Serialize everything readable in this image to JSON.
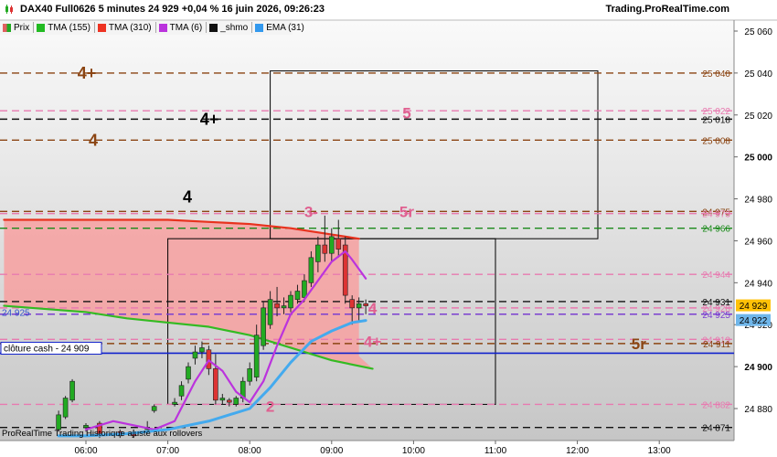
{
  "header": {
    "title": "DAX40 Full0626 5 minutes 24 929 +0,04 % 16 juin 2026, 09:26:23",
    "site": "Trading.ProRealTime.com"
  },
  "legend": [
    {
      "label": "Prix",
      "color": "#e06060"
    },
    {
      "label": "TMA (155)",
      "color": "#22bb22"
    },
    {
      "label": "TMA (310)",
      "color": "#ee3322"
    },
    {
      "label": "TMA (6)",
      "color": "#bb33dd"
    },
    {
      "label": "_shmo",
      "color": "#111111"
    },
    {
      "label": "EMA (31)",
      "color": "#3399ee"
    }
  ],
  "footer": "ProRealTime Trading  Historique ajusté aux rollovers",
  "chart_data": {
    "type": "candlestick",
    "y_ticks": [
      "25 060",
      "25 040",
      "25 020",
      "25 000",
      "24 980",
      "24 960",
      "24 940",
      "24 920",
      "24 900",
      "24 880"
    ],
    "x_ticks": [
      "06:00",
      "07:00",
      "08:00",
      "09:00",
      "10:00",
      "11:00",
      "12:00",
      "13:00"
    ],
    "ylim": [
      24866,
      25066
    ],
    "levels": [
      {
        "price": 25040,
        "color": "#8b4513",
        "label": "25 040",
        "text": "4+"
      },
      {
        "price": 25022,
        "color": "#e87ab0",
        "label": "25 022",
        "text": ""
      },
      {
        "price": 25018,
        "color": "#111111",
        "label": "25 018",
        "text": "4+"
      },
      {
        "price": 25008,
        "color": "#8b4513",
        "label": "25 008",
        "text": "4"
      },
      {
        "price": 24974,
        "color": "#8b4513",
        "label": "24 975",
        "text": "4"
      },
      {
        "price": 24973,
        "color": "#e87ab0",
        "label": "24 973",
        "text": ""
      },
      {
        "price": 24966,
        "color": "#1a8a1a",
        "label": "24 966",
        "text": ""
      },
      {
        "price": 24944,
        "color": "#e87ab0",
        "label": "24 944",
        "text": ""
      },
      {
        "price": 24931,
        "color": "#111111",
        "label": "24 931",
        "text": ""
      },
      {
        "price": 24928,
        "color": "#e87ab0",
        "label": "24 928",
        "text": ""
      },
      {
        "price": 24925,
        "color": "#7b3fd0",
        "label": "24 925",
        "text": ""
      },
      {
        "price": 24913,
        "color": "#e87ab0",
        "label": "24 913",
        "text": ""
      },
      {
        "price": 24911,
        "color": "#8b4513",
        "label": "24 911",
        "text": ""
      },
      {
        "price": 24882,
        "color": "#e87ab0",
        "label": "24 882",
        "text": ""
      },
      {
        "price": 24871,
        "color": "#111111",
        "label": "24 871",
        "text": ""
      }
    ],
    "level_texts": [
      {
        "text": "5",
        "color": "#e06090",
        "price": 25021,
        "x_time": "09:55"
      },
      {
        "text": "5r",
        "color": "#e06090",
        "price": 24974,
        "x_time": "09:55"
      },
      {
        "text": "3-",
        "color": "#e06090",
        "price": 24974,
        "x_time": "08:45"
      },
      {
        "text": "4",
        "color": "#e06090",
        "price": 24928,
        "x_time": "09:30"
      },
      {
        "text": "4+",
        "color": "#e06090",
        "price": 24912,
        "x_time": "09:30"
      },
      {
        "text": "2",
        "color": "#e06090",
        "price": 24881,
        "x_time": "08:15"
      },
      {
        "text": "5r",
        "color": "#8b4513",
        "price": 24911,
        "x_time": "12:45"
      }
    ],
    "boxes": [
      {
        "t0": "08:15",
        "t1": "12:15",
        "p0": 24961,
        "p1": 25041
      },
      {
        "t0": "07:00",
        "t1": "11:00",
        "p0": 24882,
        "p1": 24961
      }
    ],
    "right_labels": [
      {
        "text": "24 929",
        "bg": "#ffc107",
        "fg": "#000000",
        "price": 24929
      },
      {
        "text": "24 922",
        "bg": "#6fb6ea",
        "fg": "#000000",
        "price": 24922
      }
    ],
    "left_labels": [
      {
        "text": "24 925",
        "price": 24926,
        "color": "#3355cc"
      }
    ],
    "cloture": {
      "text": "clôture cash -  24 909",
      "price": 24909
    },
    "candles": [
      {
        "t": "05:40",
        "o": 24870,
        "h": 24879,
        "l": 24869,
        "c": 24877
      },
      {
        "t": "05:45",
        "o": 24876,
        "h": 24886,
        "l": 24875,
        "c": 24885
      },
      {
        "t": "05:50",
        "o": 24884,
        "h": 24894,
        "l": 24883,
        "c": 24893
      },
      {
        "t": "06:00",
        "o": 24871,
        "h": 24873,
        "l": 24869,
        "c": 24872
      },
      {
        "t": "06:10",
        "o": 24873,
        "h": 24874,
        "l": 24866,
        "c": 24868
      },
      {
        "t": "06:25",
        "o": 24869,
        "h": 24870,
        "l": 24866,
        "c": 24867
      },
      {
        "t": "06:35",
        "o": 24868,
        "h": 24870,
        "l": 24866,
        "c": 24867
      },
      {
        "t": "06:45",
        "o": 24870,
        "h": 24874,
        "l": 24868,
        "c": 24871
      },
      {
        "t": "06:50",
        "o": 24879,
        "h": 24882,
        "l": 24878,
        "c": 24881
      },
      {
        "t": "07:05",
        "o": 24882,
        "h": 24885,
        "l": 24881,
        "c": 24883
      },
      {
        "t": "07:10",
        "o": 24886,
        "h": 24893,
        "l": 24884,
        "c": 24891
      },
      {
        "t": "07:15",
        "o": 24894,
        "h": 24902,
        "l": 24892,
        "c": 24900
      },
      {
        "t": "07:20",
        "o": 24904,
        "h": 24910,
        "l": 24901,
        "c": 24907
      },
      {
        "t": "07:25",
        "o": 24907,
        "h": 24912,
        "l": 24904,
        "c": 24909
      },
      {
        "t": "07:30",
        "o": 24908,
        "h": 24910,
        "l": 24896,
        "c": 24899
      },
      {
        "t": "07:35",
        "o": 24899,
        "h": 24906,
        "l": 24882,
        "c": 24884
      },
      {
        "t": "07:40",
        "o": 24884,
        "h": 24887,
        "l": 24882,
        "c": 24885
      },
      {
        "t": "07:45",
        "o": 24884,
        "h": 24885,
        "l": 24881,
        "c": 24883
      },
      {
        "t": "07:50",
        "o": 24882,
        "h": 24886,
        "l": 24881,
        "c": 24885
      },
      {
        "t": "07:55",
        "o": 24885,
        "h": 24895,
        "l": 24883,
        "c": 24893
      },
      {
        "t": "08:00",
        "o": 24893,
        "h": 24902,
        "l": 24891,
        "c": 24899
      },
      {
        "t": "08:05",
        "o": 24895,
        "h": 24920,
        "l": 24893,
        "c": 24915
      },
      {
        "t": "08:10",
        "o": 24910,
        "h": 24931,
        "l": 24908,
        "c": 24928
      },
      {
        "t": "08:15",
        "o": 24920,
        "h": 24936,
        "l": 24918,
        "c": 24932
      },
      {
        "t": "08:20",
        "o": 24930,
        "h": 24938,
        "l": 24924,
        "c": 24928
      },
      {
        "t": "08:25",
        "o": 24928,
        "h": 24933,
        "l": 24925,
        "c": 24929
      },
      {
        "t": "08:30",
        "o": 24928,
        "h": 24936,
        "l": 24926,
        "c": 24934
      },
      {
        "t": "08:35",
        "o": 24932,
        "h": 24939,
        "l": 24930,
        "c": 24936
      },
      {
        "t": "08:40",
        "o": 24933,
        "h": 24944,
        "l": 24931,
        "c": 24941
      },
      {
        "t": "08:45",
        "o": 24940,
        "h": 24955,
        "l": 24938,
        "c": 24952
      },
      {
        "t": "08:50",
        "o": 24950,
        "h": 24962,
        "l": 24945,
        "c": 24958
      },
      {
        "t": "08:55",
        "o": 24958,
        "h": 24972,
        "l": 24950,
        "c": 24954
      },
      {
        "t": "09:00",
        "o": 24954,
        "h": 24966,
        "l": 24950,
        "c": 24962
      },
      {
        "t": "09:05",
        "o": 24961,
        "h": 24970,
        "l": 24952,
        "c": 24956
      },
      {
        "t": "09:10",
        "o": 24958,
        "h": 24962,
        "l": 24930,
        "c": 24934
      },
      {
        "t": "09:15",
        "o": 24932,
        "h": 24934,
        "l": 24920,
        "c": 24928
      },
      {
        "t": "09:20",
        "o": 24928,
        "h": 24933,
        "l": 24922,
        "c": 24930
      },
      {
        "t": "09:25",
        "o": 24930,
        "h": 24932,
        "l": 24925,
        "c": 24929
      }
    ],
    "tma155": [
      [
        "05:00",
        24929
      ],
      [
        "06:00",
        24926
      ],
      [
        "06:30",
        24923
      ],
      [
        "07:00",
        24921
      ],
      [
        "07:30",
        24919
      ],
      [
        "08:00",
        24915
      ],
      [
        "08:30",
        24909
      ],
      [
        "09:00",
        24903
      ],
      [
        "09:30",
        24899
      ]
    ],
    "tma310": [
      [
        "05:00",
        24970
      ],
      [
        "06:00",
        24970
      ],
      [
        "07:00",
        24970
      ],
      [
        "07:30",
        24969
      ],
      [
        "08:00",
        24968
      ],
      [
        "08:30",
        24966
      ],
      [
        "09:00",
        24963
      ],
      [
        "09:20",
        24961
      ]
    ],
    "tma6": [
      [
        "06:00",
        24870
      ],
      [
        "06:10",
        24872
      ],
      [
        "06:20",
        24874
      ],
      [
        "06:35",
        24872
      ],
      [
        "06:50",
        24870
      ],
      [
        "07:05",
        24874
      ],
      [
        "07:20",
        24893
      ],
      [
        "07:30",
        24903
      ],
      [
        "07:40",
        24898
      ],
      [
        "07:50",
        24888
      ],
      [
        "08:00",
        24883
      ],
      [
        "08:10",
        24893
      ],
      [
        "08:20",
        24910
      ],
      [
        "08:30",
        24925
      ],
      [
        "08:40",
        24932
      ],
      [
        "08:50",
        24941
      ],
      [
        "09:00",
        24950
      ],
      [
        "09:10",
        24955
      ],
      [
        "09:15",
        24951
      ],
      [
        "09:25",
        24942
      ]
    ],
    "ema31": [
      [
        "05:40",
        24867
      ],
      [
        "06:00",
        24867
      ],
      [
        "06:30",
        24868
      ],
      [
        "07:00",
        24870
      ],
      [
        "07:30",
        24874
      ],
      [
        "08:00",
        24880
      ],
      [
        "08:15",
        24890
      ],
      [
        "08:30",
        24902
      ],
      [
        "08:45",
        24912
      ],
      [
        "09:00",
        24917
      ],
      [
        "09:15",
        24921
      ],
      [
        "09:25",
        24922
      ]
    ]
  }
}
